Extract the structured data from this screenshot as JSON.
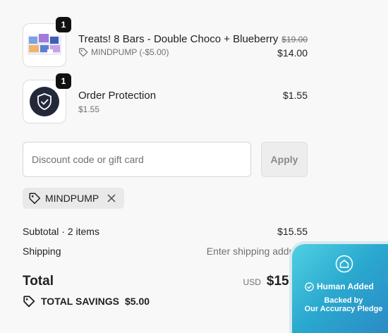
{
  "items": [
    {
      "name": "Treats! 8 Bars - Double Choco + Blueberry",
      "quantity": "1",
      "discount": "MINDPUMP (-$5.00)",
      "original_price": "$19.00",
      "price": "$14.00"
    },
    {
      "name": "Order Protection",
      "quantity": "1",
      "sub_price": "$1.55",
      "price": "$1.55"
    }
  ],
  "discount": {
    "placeholder": "Discount code or gift card",
    "apply_label": "Apply",
    "applied_code": "MINDPUMP"
  },
  "summary": {
    "subtotal_label": "Subtotal · 2 items",
    "subtotal_value": "$15.55",
    "shipping_label": "Shipping",
    "shipping_value": "Enter shipping address",
    "total_label": "Total",
    "currency": "USD",
    "total_value": "$15.55",
    "savings_label": "TOTAL SAVINGS",
    "savings_value": "$5.00"
  },
  "badge": {
    "title": "Human Added",
    "line1": "Backed by",
    "line2": "Our Accuracy Pledge"
  },
  "icons": [
    "product-thumbnail",
    "shield-check-icon",
    "tag-icon",
    "close-icon",
    "house-icon",
    "check-circle-icon"
  ],
  "colors": {
    "badge_gradient_start": "#4fd0e2",
    "badge_gradient_end": "#2c86c4",
    "qty_badge": "#111111"
  }
}
